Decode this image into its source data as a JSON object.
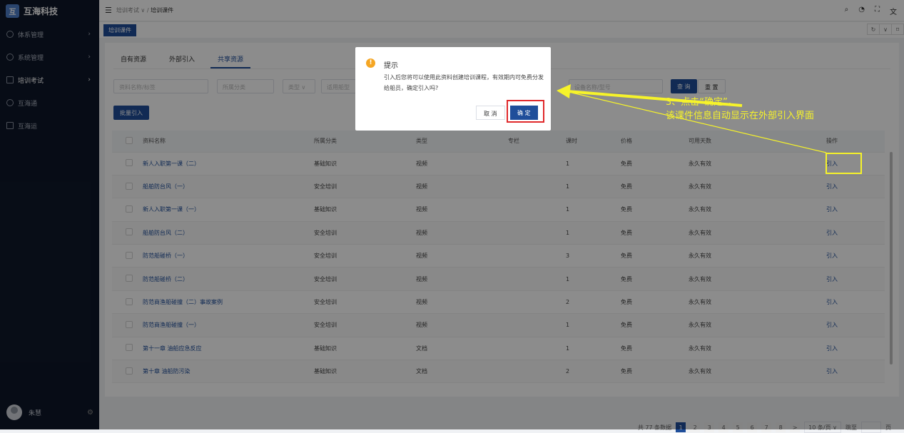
{
  "app": {
    "name": "互海科技",
    "logo_glyph": "互"
  },
  "sidebar": {
    "items": [
      {
        "label": "体系管理",
        "icon": "system-icon"
      },
      {
        "label": "系统管理",
        "icon": "settings-icon"
      },
      {
        "label": "培训考试",
        "icon": "grid-icon"
      },
      {
        "label": "互海通",
        "icon": "gear-icon"
      },
      {
        "label": "互海运",
        "icon": "ship-icon"
      }
    ],
    "user": "朱慧"
  },
  "breadcrumb": {
    "parent": "培训考试",
    "sep": "/",
    "current": "培训课件"
  },
  "tagsbar": {
    "tag": "培训课件"
  },
  "tabs": [
    "自有资源",
    "外部引入",
    "共享资源"
  ],
  "filters": {
    "name": "资料名称/标签",
    "category": "所属分类",
    "type": "类型",
    "ship": "适用船型",
    "device": "设备名称/型号",
    "query": "查 询",
    "reset": "重 置"
  },
  "batch_button": "批量引入",
  "table": {
    "headers": [
      "资料名称",
      "所属分类",
      "类型",
      "专栏",
      "课时",
      "价格",
      "可用天数",
      "操作"
    ],
    "rows": [
      [
        "新人入职第一课（二）",
        "基础知识",
        "视频",
        "",
        "1",
        "免费",
        "永久有效",
        "引入"
      ],
      [
        "船舶防台风（一）",
        "安全培训",
        "视频",
        "",
        "1",
        "免费",
        "永久有效",
        "引入"
      ],
      [
        "新人入职第一课（一）",
        "基础知识",
        "视频",
        "",
        "1",
        "免费",
        "永久有效",
        "引入"
      ],
      [
        "船舶防台风（二）",
        "安全培训",
        "视频",
        "",
        "1",
        "免费",
        "永久有效",
        "引入"
      ],
      [
        "防范船碰桥（一）",
        "安全培训",
        "视频",
        "",
        "3",
        "免费",
        "永久有效",
        "引入"
      ],
      [
        "防范船碰桥（二）",
        "安全培训",
        "视频",
        "",
        "1",
        "免费",
        "永久有效",
        "引入"
      ],
      [
        "防范商渔船碰撞（二）事故案例",
        "安全培训",
        "视频",
        "",
        "2",
        "免费",
        "永久有效",
        "引入"
      ],
      [
        "防范商渔船碰撞（一）",
        "安全培训",
        "视频",
        "",
        "1",
        "免费",
        "永久有效",
        "引入"
      ],
      [
        "第十一章 油船应急反应",
        "基础知识",
        "文档",
        "",
        "1",
        "免费",
        "永久有效",
        "引入"
      ],
      [
        "第十章 油船防污染",
        "基础知识",
        "文档",
        "",
        "2",
        "免费",
        "永久有效",
        "引入"
      ]
    ]
  },
  "pagination": {
    "total": "共 77 条数据",
    "pages": [
      "1",
      "2",
      "3",
      "4",
      "5",
      "6",
      "7",
      "8"
    ],
    "current": "1",
    "next": ">",
    "size": "10 条/页",
    "goto": "跳至",
    "page_unit": "页"
  },
  "dialog": {
    "icon": "!",
    "title": "提示",
    "message": "引入后您将可以使用此资料创建培训课程，有效期内可免费分发给船员，确定引入吗?",
    "cancel": "取 消",
    "ok": "确 定"
  },
  "annotation": {
    "line1": "3、点击“确定”，",
    "line2": "该课件信息自动显示在外部引入界面"
  },
  "colors": {
    "primary": "#1f4e9a",
    "sidebar": "#0e1729",
    "highlight_red": "#e0292b",
    "highlight_yellow": "#f6f32a"
  }
}
